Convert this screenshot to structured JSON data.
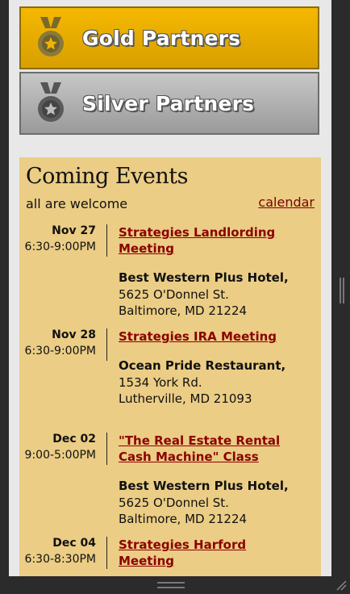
{
  "partners": [
    {
      "label": "Gold Partners",
      "medal": "gold-medal-icon"
    },
    {
      "label": "Silver Partners",
      "medal": "silver-medal-icon"
    }
  ],
  "events_panel": {
    "title": "Coming Events",
    "subtitle": "all are welcome",
    "calendar_link": "calendar"
  },
  "events": [
    {
      "date": "Nov 27",
      "time": "6:30-9:00PM",
      "title": "Strategies Landlording Meeting",
      "venue": "Best Western Plus Hotel,",
      "address1": "5625 O'Donnel St.",
      "address2": "Baltimore, MD 21224"
    },
    {
      "date": "Nov 28",
      "time": "6:30-9:00PM",
      "title": "Strategies IRA Meeting",
      "venue": "Ocean Pride Restaurant,",
      "address1": "1534 York Rd.",
      "address2": "Lutherville, MD 21093"
    },
    {
      "date": "Dec 02",
      "time": "9:00-5:00PM",
      "title": "\"The Real Estate Rental Cash Machine\" Class",
      "venue": "Best Western Plus Hotel,",
      "address1": "5625 O'Donnel St.",
      "address2": "Baltimore, MD 21224"
    },
    {
      "date": "Dec 04",
      "time": "6:30-8:30PM",
      "title": "Strategies Harford Meeting",
      "venue": "",
      "address1": "",
      "address2": ""
    }
  ],
  "colors": {
    "gold": "#f5b800",
    "silver": "#b0b0b0",
    "events_bg": "#ebcd85",
    "link": "#8b0000"
  }
}
